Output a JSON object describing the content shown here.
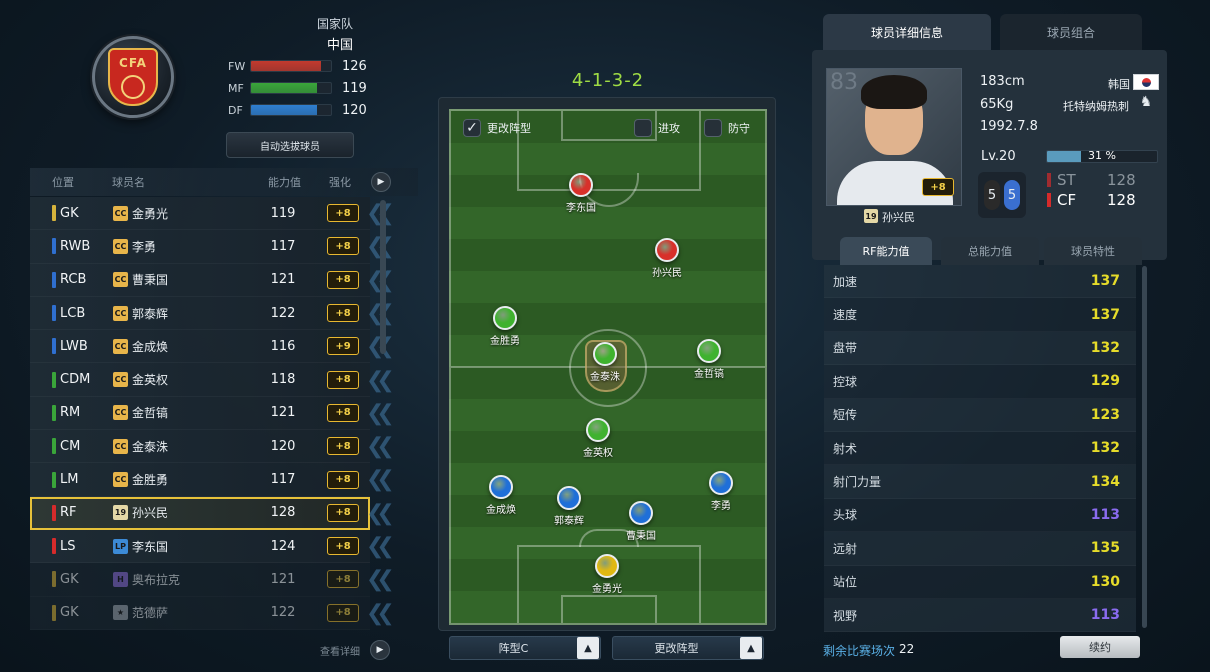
{
  "team": {
    "type": "国家队",
    "name": "中国",
    "badge_text": "CFA",
    "ratings": [
      {
        "label": "FW",
        "value": "126",
        "fill": 0.87,
        "color": "#c23a2e"
      },
      {
        "label": "MF",
        "value": "119",
        "fill": 0.82,
        "color": "#3aa53a"
      },
      {
        "label": "DF",
        "value": "120",
        "fill": 0.83,
        "color": "#2f7fd0"
      }
    ],
    "auto_select_label": "自动选拔球员"
  },
  "list": {
    "headers": {
      "pos": "位置",
      "name": "球员名",
      "rating": "能力值",
      "enhance": "强化"
    },
    "arrow": "▶",
    "detail_link": "查看详细",
    "players": [
      {
        "pos": "GK",
        "pos_color": "#d6b33c",
        "badge": "CC",
        "badge_color": "#e8b54a",
        "name": "金勇光",
        "rating": "119",
        "enhance": "+8"
      },
      {
        "pos": "RWB",
        "pos_color": "#2f6fd0",
        "badge": "CC",
        "badge_color": "#e8b54a",
        "name": "李勇",
        "rating": "117",
        "enhance": "+8"
      },
      {
        "pos": "RCB",
        "pos_color": "#2f6fd0",
        "badge": "CC",
        "badge_color": "#e8b54a",
        "name": "曹秉国",
        "rating": "121",
        "enhance": "+8"
      },
      {
        "pos": "LCB",
        "pos_color": "#2f6fd0",
        "badge": "CC",
        "badge_color": "#e8b54a",
        "name": "郭泰辉",
        "rating": "122",
        "enhance": "+8"
      },
      {
        "pos": "LWB",
        "pos_color": "#2f6fd0",
        "badge": "CC",
        "badge_color": "#e8b54a",
        "name": "金成焕",
        "rating": "116",
        "enhance": "+9"
      },
      {
        "pos": "CDM",
        "pos_color": "#3aa53a",
        "badge": "CC",
        "badge_color": "#e8b54a",
        "name": "金英权",
        "rating": "118",
        "enhance": "+8"
      },
      {
        "pos": "RM",
        "pos_color": "#3aa53a",
        "badge": "CC",
        "badge_color": "#e8b54a",
        "name": "金哲镐",
        "rating": "121",
        "enhance": "+8"
      },
      {
        "pos": "CM",
        "pos_color": "#3aa53a",
        "badge": "CC",
        "badge_color": "#e8b54a",
        "name": "金泰洙",
        "rating": "120",
        "enhance": "+8"
      },
      {
        "pos": "LM",
        "pos_color": "#3aa53a",
        "badge": "CC",
        "badge_color": "#e8b54a",
        "name": "金胜勇",
        "rating": "117",
        "enhance": "+8"
      },
      {
        "pos": "RF",
        "pos_color": "#d62b2b",
        "badge": "19",
        "badge_color": "#e4d8a6",
        "name": "孙兴民",
        "rating": "128",
        "enhance": "+8"
      },
      {
        "pos": "LS",
        "pos_color": "#d62b2b",
        "badge": "LP",
        "badge_color": "#3c8ad6",
        "name": "李东国",
        "rating": "124",
        "enhance": "+8"
      },
      {
        "pos": "GK",
        "pos_color": "#d6b33c",
        "badge": "H",
        "badge_color": "#8b6fd6",
        "name": "奥布拉克",
        "rating": "121",
        "enhance": "+8"
      },
      {
        "pos": "GK",
        "pos_color": "#d6b33c",
        "badge": "★",
        "badge_color": "#9aa4ad",
        "name": "范德萨",
        "rating": "122",
        "enhance": "+8"
      }
    ]
  },
  "pitch": {
    "formation": "4-1-3-2",
    "check_change": "更改阵型",
    "check_attack": "进攻",
    "check_defense": "防守",
    "tokens": [
      {
        "name": "李东国",
        "color": "#d8302a"
      },
      {
        "name": "孙兴民",
        "color": "#d8302a"
      },
      {
        "name": "金胜勇",
        "color": "#3fb22f"
      },
      {
        "name": "金泰洙",
        "color": "#3fb22f"
      },
      {
        "name": "金哲镐",
        "color": "#3fb22f"
      },
      {
        "name": "金英权",
        "color": "#3fb22f"
      },
      {
        "name": "金成焕",
        "color": "#1f6fd8"
      },
      {
        "name": "郭泰辉",
        "color": "#1f6fd8"
      },
      {
        "name": "曹秉国",
        "color": "#1f6fd8"
      },
      {
        "name": "李勇",
        "color": "#1f6fd8"
      },
      {
        "name": "金勇光",
        "color": "#e0b812"
      }
    ],
    "formation_button": "阵型C",
    "change_button": "更改阵型",
    "arrow": "▲"
  },
  "detail": {
    "tab_detail": "球员详细信息",
    "tab_combo": "球员组合",
    "ovr": "83",
    "height": "183cm",
    "weight": "65Kg",
    "birthday": "1992.7.8",
    "nation": "韩国",
    "club": "托特纳姆热刺",
    "club_crest": "♞",
    "level": "Lv.20",
    "exp_fraction": 0.31,
    "exp_label": "31 %",
    "enhance": "+8",
    "boot_left": "5",
    "boot_right": "5",
    "positions": [
      {
        "pos": "ST",
        "value": "128",
        "dim": true
      },
      {
        "pos": "CF",
        "value": "128",
        "dim": false
      }
    ],
    "card_badge": "19",
    "card_name": "孙兴民"
  },
  "stats": {
    "tab_rf": "RF能力值",
    "tab_total": "总能力值",
    "tab_traits": "球员特性",
    "items": [
      {
        "name": "加速",
        "value": "137",
        "color": "#e6dc2a"
      },
      {
        "name": "速度",
        "value": "137",
        "color": "#e6dc2a"
      },
      {
        "name": "盘带",
        "value": "132",
        "color": "#e6dc2a"
      },
      {
        "name": "控球",
        "value": "129",
        "color": "#e6dc2a"
      },
      {
        "name": "短传",
        "value": "123",
        "color": "#e6dc2a"
      },
      {
        "name": "射术",
        "value": "132",
        "color": "#e6dc2a"
      },
      {
        "name": "射门力量",
        "value": "134",
        "color": "#e6dc2a"
      },
      {
        "name": "头球",
        "value": "113",
        "color": "#8a6cf0"
      },
      {
        "name": "远射",
        "value": "135",
        "color": "#e6dc2a"
      },
      {
        "name": "站位",
        "value": "130",
        "color": "#e6dc2a"
      },
      {
        "name": "视野",
        "value": "113",
        "color": "#8a6cf0"
      }
    ]
  },
  "footer": {
    "remaining_label": "剩余比赛场次",
    "remaining_count": "22",
    "renew_label": "续约"
  }
}
